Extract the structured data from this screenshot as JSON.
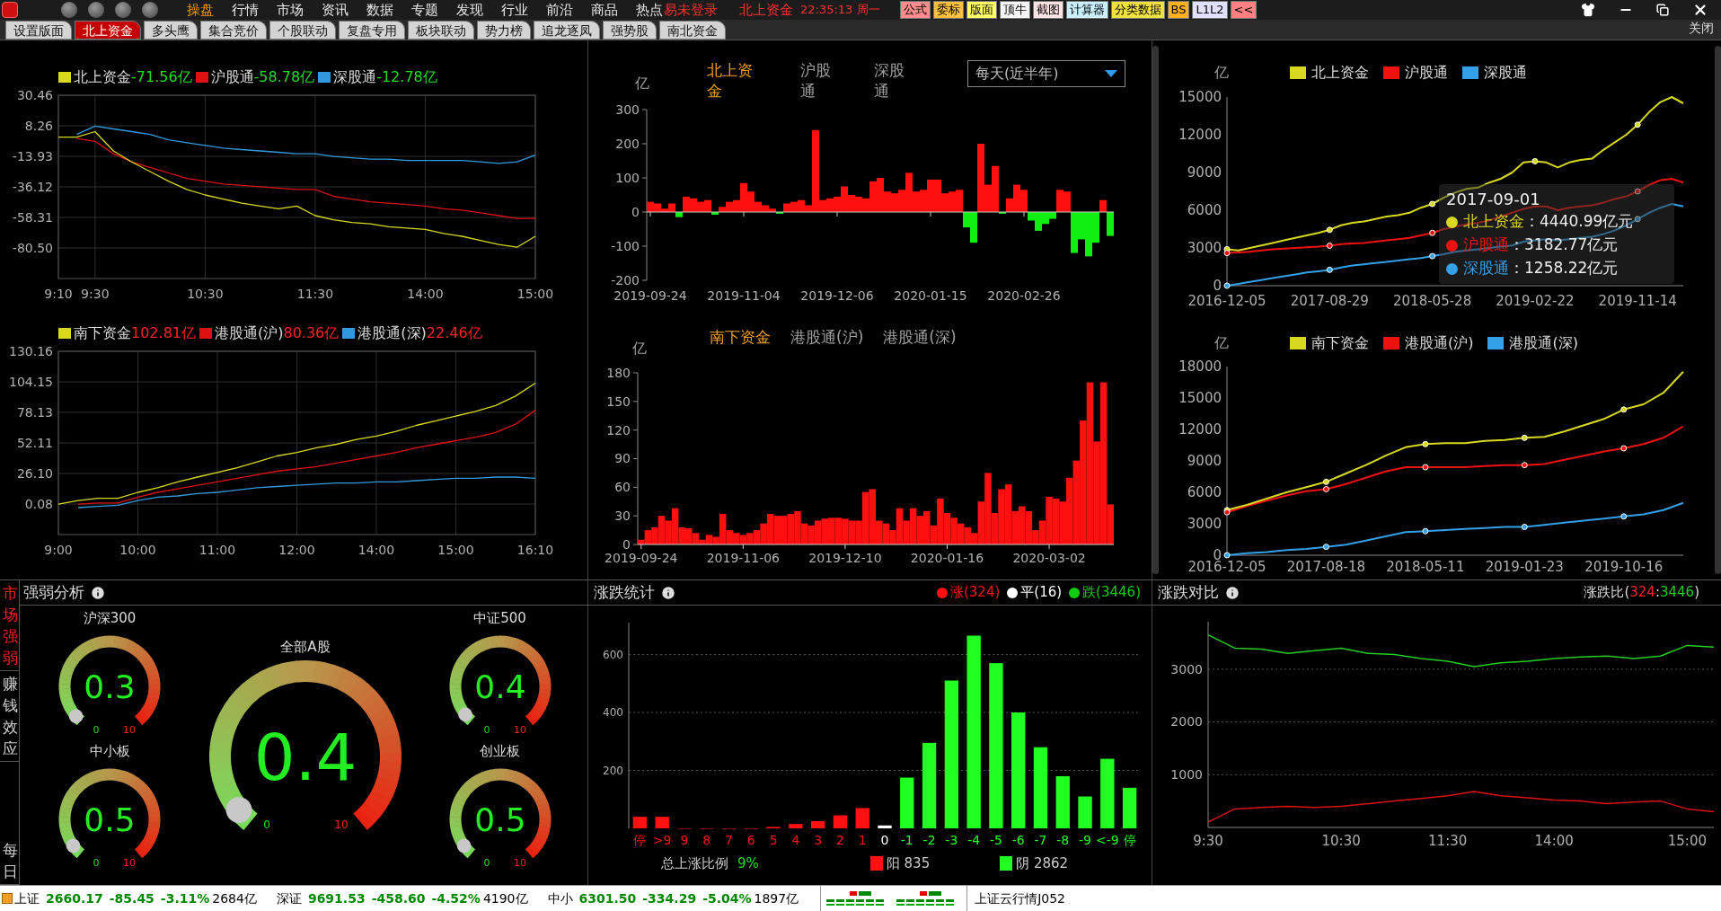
{
  "menu_bar": {
    "menu_items": [
      {
        "label": "操盘",
        "selected": true
      },
      {
        "label": "行情",
        "selected": false
      },
      {
        "label": "市场",
        "selected": false
      },
      {
        "label": "资讯",
        "selected": false
      },
      {
        "label": "数据",
        "selected": false
      },
      {
        "label": "专题",
        "selected": false
      },
      {
        "label": "发现",
        "selected": false
      },
      {
        "label": "行业",
        "selected": false
      },
      {
        "label": "前沿",
        "selected": false
      },
      {
        "label": "商品",
        "selected": false
      },
      {
        "label": "热点",
        "selected": false
      }
    ],
    "login_status": "易未登录",
    "module": "北上资金",
    "clock": "22:35:13 周一",
    "tool_buttons": [
      {
        "label": "公式",
        "color": "#ff8c8c"
      },
      {
        "label": "委标",
        "color": "#ffc040"
      },
      {
        "label": "版面",
        "color": "#ffff66"
      },
      {
        "label": "顶牛",
        "color": "#f4f4f4"
      },
      {
        "label": "截图",
        "color": "#ffe4e4"
      },
      {
        "label": "计算器",
        "color": "#c8f0ff"
      },
      {
        "label": "分类数据",
        "color": "#f0e040"
      },
      {
        "label": "BS",
        "color": "#ffb020"
      },
      {
        "label": "L1L2",
        "color": "#e0e0ff"
      },
      {
        "label": "<<",
        "color": "#ff8080"
      }
    ]
  },
  "tabs": [
    {
      "label": "设置版面",
      "selected": false
    },
    {
      "label": "北上资金",
      "selected": true
    },
    {
      "label": "多头鹰",
      "selected": false
    },
    {
      "label": "集合竞价",
      "selected": false
    },
    {
      "label": "个股联动",
      "selected": false
    },
    {
      "label": "复盘专用",
      "selected": false
    },
    {
      "label": "板块联动",
      "selected": false
    },
    {
      "label": "势力榜",
      "selected": false
    },
    {
      "label": "追龙逐凤",
      "selected": false
    },
    {
      "label": "强势股",
      "selected": false
    },
    {
      "label": "南北资金",
      "selected": false
    }
  ],
  "close_tab": "关闭",
  "north_intraday": {
    "readings": [
      {
        "text": "-71.56亿",
        "color": "#22dd22"
      },
      {
        "text": "-58.78亿",
        "color": "#22dd22"
      },
      {
        "text": "-12.78亿",
        "color": "#22dd22"
      }
    ],
    "chart_data": {
      "type": "line",
      "grid": true,
      "ylim": [
        -102.69,
        30.46
      ],
      "categories": [
        "9:10",
        null,
        "9:30",
        null,
        null,
        null,
        null,
        null,
        "10:30",
        null,
        null,
        null,
        null,
        null,
        "11:30",
        null,
        null,
        null,
        null,
        null,
        "14:00",
        null,
        null,
        null,
        null,
        null,
        "15:00"
      ],
      "yticks": [
        {
          "value": 30.46,
          "label": "30.46"
        },
        {
          "value": 8.26,
          "label": "8.26"
        },
        {
          "value": -13.93,
          "label": "-13.93"
        },
        {
          "value": -36.12,
          "label": "-36.12"
        },
        {
          "value": -58.31,
          "label": "-58.31"
        },
        {
          "value": -80.5,
          "label": "-80.50"
        }
      ],
      "series": [
        {
          "name": "北上资金",
          "color": "#d8d820",
          "values": [
            0,
            0,
            4,
            -10,
            -18,
            -25,
            -32,
            -38,
            -42,
            -45,
            -48,
            -50,
            -52,
            -50,
            -57,
            -60,
            -62,
            -63,
            -65,
            -66,
            -67,
            -70,
            -72,
            -75,
            -78,
            -80,
            -72
          ]
        },
        {
          "name": "沪股通",
          "color": "#dd1111",
          "values": [
            null,
            -1,
            -3,
            -12,
            -18,
            -22,
            -26,
            -30,
            -32,
            -34,
            -35,
            -36,
            -37,
            -38,
            -38,
            -43,
            -45,
            -47,
            -48,
            -49,
            -50,
            -52,
            -53,
            -55,
            -57,
            -59,
            -59
          ]
        },
        {
          "name": "深股通",
          "color": "#3399dd",
          "values": [
            null,
            2,
            8,
            6,
            4,
            2,
            -2,
            -4,
            -6,
            -8,
            -9,
            -10,
            -11,
            -12,
            -12,
            -14,
            -15,
            -16,
            -16,
            -17,
            -17,
            -17,
            -17,
            -18,
            -19,
            -18,
            -13
          ]
        }
      ]
    }
  },
  "south_intraday": {
    "readings": [
      {
        "text": "102.81亿",
        "color": "#ff2222"
      },
      {
        "text": "80.36亿",
        "color": "#ff2222"
      },
      {
        "text": "22.46亿",
        "color": "#ff2222"
      }
    ],
    "chart_data": {
      "type": "line",
      "grid": true,
      "ylim": [
        -25.94,
        130.16
      ],
      "categories": [
        "9:00",
        null,
        null,
        null,
        "10:00",
        null,
        null,
        null,
        "11:00",
        null,
        null,
        null,
        "12:00",
        null,
        null,
        null,
        "14:00",
        null,
        null,
        null,
        "15:00",
        null,
        null,
        null,
        "16:10"
      ],
      "yticks": [
        {
          "value": 130.16,
          "label": "130.16"
        },
        {
          "value": 104.15,
          "label": "104.15"
        },
        {
          "value": 78.13,
          "label": "78.13"
        },
        {
          "value": 52.11,
          "label": "52.11"
        },
        {
          "value": 26.1,
          "label": "26.10"
        },
        {
          "value": 0.08,
          "label": "0.08"
        }
      ],
      "series": [
        {
          "name": "南下资金",
          "color": "#d8d820",
          "values": [
            0,
            3,
            5,
            5,
            10,
            14,
            19,
            23,
            27,
            31,
            36,
            41,
            44,
            48,
            51,
            55,
            58,
            62,
            67,
            71,
            75,
            79,
            84,
            92,
            103
          ]
        },
        {
          "name": "港股通(沪)",
          "color": "#dd1111",
          "values": [
            null,
            0,
            1,
            1,
            6,
            10,
            13,
            16,
            19,
            22,
            25,
            28,
            30,
            32,
            35,
            38,
            41,
            44,
            48,
            51,
            54,
            57,
            61,
            68,
            80
          ]
        },
        {
          "name": "港股通(深)",
          "color": "#3399dd",
          "values": [
            null,
            -3,
            -2,
            -1,
            3,
            6,
            7,
            9,
            10,
            12,
            14,
            15,
            16,
            17,
            18,
            18,
            19,
            19,
            20,
            21,
            22,
            22,
            23,
            23,
            22
          ]
        }
      ]
    }
  },
  "north_daily": {
    "series_tabs": [
      {
        "label": "北上资金",
        "selected": true
      },
      {
        "label": "沪股通",
        "selected": false
      },
      {
        "label": "深股通",
        "selected": false
      }
    ],
    "period_select": "每天(近半年)",
    "chart_data": {
      "type": "bar",
      "ylabel": "亿",
      "ylim": [
        -200,
        300
      ],
      "yticks": [
        -200,
        -100,
        0,
        100,
        200,
        300
      ],
      "categories": [
        "2019-09-24",
        null,
        null,
        null,
        null,
        null,
        null,
        null,
        null,
        null,
        null,
        null,
        null,
        "2019-11-04",
        null,
        null,
        null,
        null,
        null,
        null,
        null,
        null,
        null,
        null,
        null,
        null,
        "2019-12-06",
        null,
        null,
        null,
        null,
        null,
        null,
        null,
        null,
        null,
        null,
        null,
        null,
        "2020-01-15",
        null,
        null,
        null,
        null,
        null,
        null,
        null,
        null,
        null,
        null,
        null,
        null,
        "2020-02-26",
        null,
        null,
        null,
        null,
        null,
        null,
        null,
        null,
        null,
        null,
        null,
        null
      ],
      "values": [
        30,
        25,
        10,
        25,
        -15,
        45,
        40,
        30,
        35,
        -8,
        15,
        30,
        35,
        85,
        60,
        30,
        20,
        10,
        -5,
        25,
        30,
        35,
        20,
        240,
        35,
        40,
        45,
        75,
        50,
        45,
        40,
        90,
        100,
        60,
        55,
        65,
        115,
        60,
        65,
        95,
        95,
        55,
        60,
        65,
        -45,
        -90,
        200,
        80,
        135,
        -5,
        40,
        80,
        65,
        -25,
        -55,
        -35,
        -20,
        65,
        60,
        -120,
        -80,
        -130,
        -90,
        35,
        -70
      ]
    }
  },
  "south_daily": {
    "series_tabs": [
      {
        "label": "南下资金",
        "selected": true
      },
      {
        "label": "港股通(沪)",
        "selected": false
      },
      {
        "label": "港股通(深)",
        "selected": false
      }
    ],
    "chart_data": {
      "type": "bar",
      "ylabel": "亿",
      "ylim": [
        0,
        180
      ],
      "yticks": [
        0,
        30,
        60,
        90,
        120,
        150,
        180
      ],
      "categories": [
        "2019-09-24",
        null,
        null,
        null,
        null,
        null,
        null,
        null,
        null,
        null,
        null,
        null,
        null,
        null,
        null,
        "2019-11-06",
        null,
        null,
        null,
        null,
        null,
        null,
        null,
        null,
        null,
        null,
        null,
        null,
        null,
        null,
        "2019-12-10",
        null,
        null,
        null,
        null,
        null,
        null,
        null,
        null,
        null,
        null,
        null,
        null,
        null,
        null,
        "2020-01-16",
        null,
        null,
        null,
        null,
        null,
        null,
        null,
        null,
        null,
        null,
        null,
        null,
        null,
        null,
        "2020-03-02",
        null,
        null,
        null,
        null,
        null,
        null,
        null,
        null,
        null
      ],
      "values": [
        5,
        15,
        18,
        30,
        25,
        38,
        18,
        17,
        12,
        5,
        10,
        8,
        32,
        15,
        12,
        10,
        12,
        15,
        22,
        32,
        30,
        30,
        32,
        35,
        22,
        20,
        25,
        27,
        28,
        28,
        27,
        25,
        25,
        55,
        58,
        25,
        22,
        15,
        38,
        25,
        38,
        30,
        35,
        20,
        48,
        33,
        28,
        22,
        18,
        12,
        45,
        75,
        33,
        58,
        63,
        35,
        40,
        35,
        15,
        25,
        50,
        48,
        45,
        70,
        88,
        130,
        170,
        108,
        170,
        42
      ]
    }
  },
  "north_history": {
    "chart_data": {
      "type": "line",
      "ylabel": "亿",
      "ylim": [
        0,
        15000
      ],
      "yticks": [
        0,
        3000,
        6000,
        9000,
        12000,
        15000
      ],
      "categories": [
        "2016-12-05",
        null,
        null,
        null,
        null,
        null,
        null,
        null,
        null,
        "2017-08-29",
        null,
        null,
        null,
        null,
        null,
        null,
        null,
        null,
        "2018-05-28",
        null,
        null,
        null,
        null,
        null,
        null,
        null,
        null,
        "2019-02-22",
        null,
        null,
        null,
        null,
        null,
        null,
        null,
        null,
        "2019-11-14",
        null,
        null,
        null,
        null
      ],
      "series": [
        {
          "name": "北上资金",
          "color": "#d8d820",
          "values": [
            2900,
            2800,
            3000,
            3200,
            3400,
            3600,
            3800,
            4000,
            4200,
            4440,
            4800,
            5000,
            5100,
            5300,
            5500,
            5600,
            5800,
            6200,
            6500,
            7000,
            7400,
            7700,
            7800,
            8200,
            8500,
            9000,
            9800,
            9900,
            9800,
            9400,
            9800,
            10000,
            10100,
            10800,
            11400,
            12000,
            12800,
            13800,
            14600,
            15000,
            14500
          ]
        },
        {
          "name": "沪股通",
          "color": "#ee1111",
          "values": [
            2600,
            2650,
            2700,
            2800,
            2900,
            2950,
            3000,
            3050,
            3100,
            3180,
            3300,
            3350,
            3400,
            3500,
            3600,
            3700,
            3800,
            4000,
            4200,
            4500,
            4700,
            4900,
            5000,
            5200,
            5500,
            5800,
            6100,
            6300,
            6300,
            6000,
            6200,
            6300,
            6400,
            6600,
            6900,
            7100,
            7500,
            8000,
            8400,
            8500,
            8200
          ]
        },
        {
          "name": "深股通",
          "color": "#33a0e8",
          "values": [
            0,
            150,
            300,
            450,
            600,
            750,
            900,
            1050,
            1150,
            1260,
            1450,
            1600,
            1700,
            1800,
            1900,
            2000,
            2100,
            2200,
            2350,
            2500,
            2700,
            2800,
            2900,
            3000,
            3100,
            3200,
            3500,
            3600,
            3700,
            3600,
            3700,
            3800,
            3900,
            4100,
            4400,
            4800,
            5300,
            5800,
            6200,
            6500,
            6300
          ]
        }
      ]
    },
    "tooltip": {
      "date": "2017-09-01",
      "rows": [
        {
          "name": "北上资金",
          "value": "：4440.99亿元",
          "color": "#d8d820"
        },
        {
          "name": "沪股通",
          "value": "：3182.77亿元",
          "color": "#ee1111"
        },
        {
          "name": "深股通",
          "value": "：1258.22亿元",
          "color": "#33a0e8"
        }
      ]
    }
  },
  "south_history": {
    "chart_data": {
      "type": "line",
      "ylabel": "亿",
      "ylim": [
        0,
        18000
      ],
      "yticks": [
        0,
        3000,
        6000,
        9000,
        12000,
        15000,
        18000
      ],
      "categories": [
        "2016-12-05",
        null,
        null,
        null,
        null,
        "2017-08-18",
        null,
        null,
        null,
        null,
        "2018-05-11",
        null,
        null,
        null,
        null,
        "2019-01-23",
        null,
        null,
        null,
        null,
        "2019-10-16",
        null,
        null,
        null
      ],
      "series": [
        {
          "name": "南下资金",
          "color": "#d8d820",
          "values": [
            4300,
            4800,
            5400,
            6000,
            6500,
            7000,
            7800,
            8600,
            9500,
            10300,
            10600,
            10700,
            10700,
            10900,
            11000,
            11200,
            11300,
            11800,
            12400,
            13000,
            13900,
            14400,
            15500,
            17500
          ]
        },
        {
          "name": "港股通(沪)",
          "color": "#ee1111",
          "values": [
            4100,
            4700,
            5200,
            5700,
            6100,
            6300,
            6800,
            7400,
            8000,
            8400,
            8400,
            8400,
            8400,
            8500,
            8600,
            8600,
            8700,
            9100,
            9500,
            9900,
            10200,
            10600,
            11200,
            12300
          ]
        },
        {
          "name": "港股通(深)",
          "color": "#33a0e8",
          "values": [
            0,
            200,
            300,
            500,
            600,
            800,
            1000,
            1400,
            1800,
            2200,
            2300,
            2400,
            2500,
            2600,
            2700,
            2700,
            2900,
            3100,
            3300,
            3500,
            3700,
            3900,
            4300,
            5000
          ]
        }
      ]
    }
  },
  "strength": {
    "title": "强弱分析",
    "side_tabs": [
      {
        "label": "市场强弱",
        "selected": true
      },
      {
        "label": "赚钱效应",
        "selected": false
      },
      {
        "label": "每日",
        "selected": false
      }
    ],
    "gauges": [
      {
        "kind": "small",
        "title": "沪深300",
        "value": "0.3",
        "scale_min": "0",
        "scale_max": "10"
      },
      {
        "kind": "small",
        "title": "中小板",
        "value": "0.5",
        "scale_min": "0",
        "scale_max": "10"
      },
      {
        "kind": "large",
        "title": "全部A股",
        "value": "0.4",
        "scale_min": "0",
        "scale_max": "10"
      },
      {
        "kind": "small",
        "title": "中证500",
        "value": "0.4",
        "scale_min": "0",
        "scale_max": "10"
      },
      {
        "kind": "small",
        "title": "创业板",
        "value": "0.5",
        "scale_min": "0",
        "scale_max": "10"
      }
    ]
  },
  "advance_decline": {
    "title": "涨跌统计",
    "legend": [
      {
        "label": "涨(324)",
        "color": "#ff1111"
      },
      {
        "label": "平(16)",
        "color": "#ffffff"
      },
      {
        "label": "跌(3446)",
        "color": "#11cc11"
      }
    ],
    "chart_data": {
      "type": "bar",
      "grid": true,
      "ylim": [
        0,
        710
      ],
      "yticks": [
        200,
        400,
        600
      ],
      "categories": [
        "停",
        ">9",
        "9",
        "8",
        "7",
        "6",
        "5",
        "4",
        "3",
        "2",
        "1",
        "0",
        "-1",
        "-2",
        "-3",
        "-4",
        "-5",
        "-6",
        "-7",
        "-8",
        "-9",
        "<-9",
        "停"
      ],
      "series": [
        {
          "color": "#ff1111",
          "values": [
            40,
            40,
            0,
            0,
            0,
            0,
            5,
            15,
            25,
            45,
            70,
            null,
            null,
            null,
            null,
            null,
            null,
            null,
            null,
            null,
            null,
            null,
            null
          ]
        },
        {
          "color": "#ffffff",
          "values": [
            null,
            null,
            null,
            null,
            null,
            null,
            null,
            null,
            null,
            null,
            null,
            10,
            null,
            null,
            null,
            null,
            null,
            null,
            null,
            null,
            null,
            null,
            null
          ]
        },
        {
          "color": "#22ff22",
          "values": [
            null,
            null,
            null,
            null,
            null,
            null,
            null,
            null,
            null,
            null,
            null,
            null,
            175,
            295,
            510,
            665,
            570,
            400,
            280,
            180,
            110,
            240,
            140
          ]
        }
      ]
    },
    "summary": {
      "label": "总上涨比例",
      "value": "9%"
    },
    "candles": [
      {
        "label": "阳 835",
        "color": "#ff1111"
      },
      {
        "label": "阴 2862",
        "color": "#22ff22"
      }
    ]
  },
  "ratio": {
    "title": "涨跌对比",
    "ratio_parts": [
      {
        "text": "涨跌比(",
        "color": "#dddddd"
      },
      {
        "text": "324",
        "color": "#ff2222"
      },
      {
        "text": ":",
        "color": "#dddddd"
      },
      {
        "text": "3446",
        "color": "#22cc22"
      },
      {
        "text": ")",
        "color": "#dddddd"
      }
    ],
    "chart_data": {
      "type": "line",
      "grid": true,
      "ylim": [
        0,
        3900
      ],
      "yticks": [
        1000,
        2000,
        3000
      ],
      "categories": [
        "9:30",
        null,
        null,
        null,
        null,
        "10:30",
        null,
        null,
        null,
        "11:30",
        null,
        null,
        null,
        "14:00",
        null,
        null,
        null,
        null,
        "15:00",
        null
      ],
      "series": [
        {
          "color": "#22cc22",
          "values": [
            3650,
            3400,
            3380,
            3300,
            3350,
            3400,
            3300,
            3280,
            3200,
            3150,
            3050,
            3120,
            3150,
            3200,
            3230,
            3250,
            3200,
            3250,
            3450,
            3420
          ]
        },
        {
          "color": "#dd1111",
          "values": [
            100,
            350,
            380,
            400,
            380,
            400,
            450,
            500,
            550,
            600,
            680,
            600,
            560,
            520,
            500,
            450,
            480,
            500,
            350,
            300
          ]
        }
      ]
    }
  },
  "status_bar": {
    "indices": [
      {
        "name": "上证",
        "price": "2660.17",
        "change": "-85.45",
        "percent": "-3.11%",
        "volume": "2684亿"
      },
      {
        "name": "深证",
        "price": "9691.53",
        "change": "-458.60",
        "percent": "-4.52%",
        "volume": "4190亿"
      },
      {
        "name": "中小",
        "price": "6301.50",
        "change": "-334.29",
        "percent": "-5.04%",
        "volume": "1897亿"
      }
    ],
    "ticker": "上证云行情J052"
  }
}
